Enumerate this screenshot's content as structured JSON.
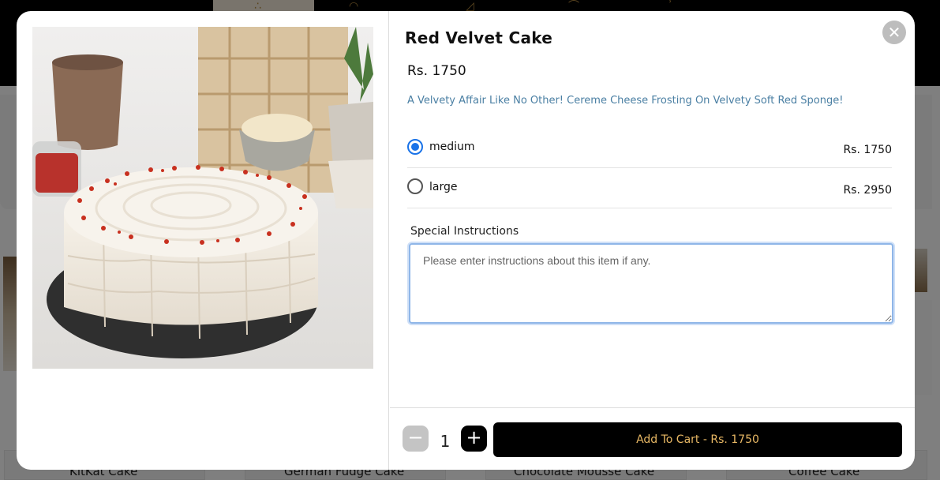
{
  "background": {
    "product_names": [
      "KitKat Cake",
      "German Fudge Cake",
      "Chocolate Mousse Cake",
      "Coffee Cake"
    ]
  },
  "modal": {
    "title": "Red Velvet Cake",
    "price": "Rs. 1750",
    "description": "A Velvety Affair Like No Other! Cereme Cheese Frosting On Velvety Soft Red Sponge!",
    "close_icon": "close-icon",
    "options": [
      {
        "label": "medium",
        "price": "Rs. 1750",
        "selected": true
      },
      {
        "label": "large",
        "price": "Rs. 2950",
        "selected": false
      }
    ],
    "instructions": {
      "label": "Special Instructions",
      "placeholder": "Please enter instructions about this item if any.",
      "value": ""
    },
    "quantity": {
      "value": "1",
      "minus_symbol": "−",
      "plus_symbol": "+"
    },
    "add_to_cart_label": "Add To Cart - Rs. 1750"
  },
  "colors": {
    "accent_text": "#e7b764",
    "description": "#4a7fa3",
    "radio_selected": "#1a73e8",
    "focus_border": "#8fb6e8"
  }
}
